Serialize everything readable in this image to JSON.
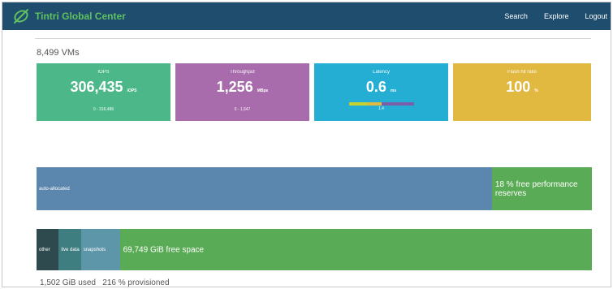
{
  "app": {
    "title": "Tintri Global Center",
    "logo_color": "#5fc25f",
    "topbar_color": "#1f4d6e"
  },
  "nav": {
    "items": [
      "Search",
      "Explore",
      "Logout"
    ]
  },
  "summary": {
    "vm_count": "8,499 VMs"
  },
  "cards": {
    "iops": {
      "label": "IOPS",
      "value": "306,435",
      "unit": "IOPS",
      "range": "0 - 316,486",
      "color": "#4cb88a"
    },
    "throughput": {
      "label": "Throughput",
      "value": "1,256",
      "unit": "MBps",
      "range": "0 - 1,647",
      "color": "#a86bab"
    },
    "latency": {
      "label": "Latency",
      "value": "0.6",
      "unit": "ms",
      "sub_value": "1.4",
      "color": "#25aed3"
    },
    "flash": {
      "label": "Flash hit ratio",
      "value": "100",
      "unit": "%",
      "color": "#e1b840"
    }
  },
  "performance_bar": {
    "segments": [
      {
        "label": "auto-allocated",
        "fraction": 0.82,
        "color": "#5b86ae"
      },
      {
        "label": "18 % free performance reserves",
        "fraction": 0.18,
        "color": "#5aab55"
      }
    ]
  },
  "space_bar": {
    "segments": [
      {
        "label": "other",
        "fraction": 0.04,
        "color": "#2e4a4e"
      },
      {
        "label": "live data",
        "fraction": 0.04,
        "color": "#3f7e80"
      },
      {
        "label": "snapshots",
        "fraction": 0.07,
        "color": "#5d95a9"
      },
      {
        "label": "69,749 GiB free space",
        "fraction": 0.85,
        "color": "#5aab55"
      }
    ]
  },
  "footer": {
    "used": "1,502 GiB used",
    "provisioned": "216 % provisioned"
  }
}
